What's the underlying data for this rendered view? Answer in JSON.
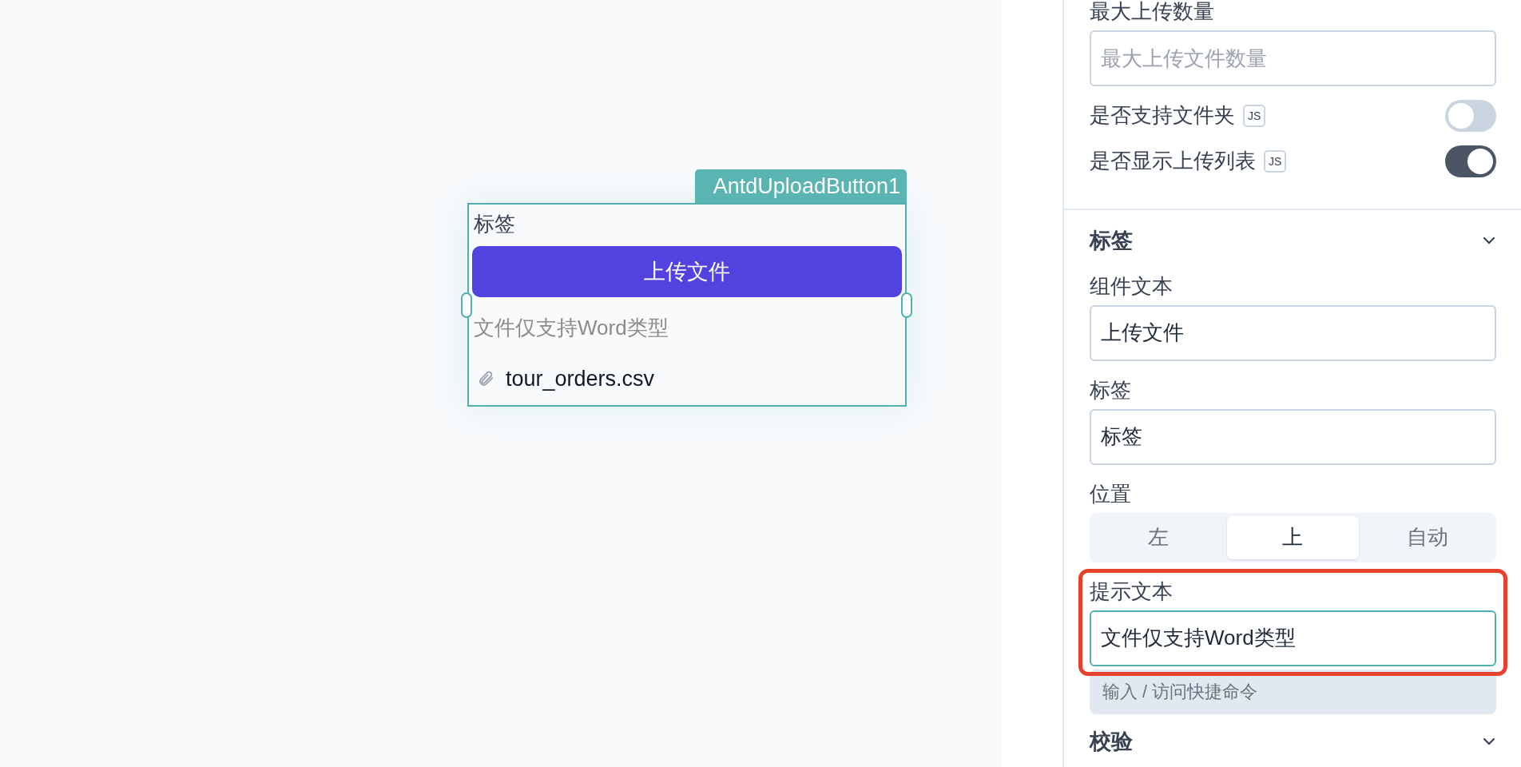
{
  "canvas": {
    "component": {
      "tag": "AntdUploadButton1",
      "label": "标签",
      "button": "上传文件",
      "hint": "文件仅支持Word类型",
      "files": [
        {
          "name": "tour_orders.csv"
        }
      ]
    }
  },
  "panel": {
    "max_upload": {
      "label": "最大上传数量",
      "placeholder": "最大上传文件数量"
    },
    "toggles": [
      {
        "label": "是否支持文件夹",
        "badge": "JS",
        "on": false
      },
      {
        "label": "是否显示上传列表",
        "badge": "JS",
        "on": true
      }
    ],
    "label_section": {
      "title": "标签",
      "expanded": true,
      "fields": [
        {
          "label": "组件文本",
          "value": "上传文件",
          "focused": false,
          "highlighted": false
        },
        {
          "label": "标签",
          "value": "标签",
          "focused": false,
          "highlighted": false
        }
      ],
      "position": {
        "label": "位置",
        "options": [
          {
            "label": "左",
            "selected": false
          },
          {
            "label": "上",
            "selected": true
          },
          {
            "label": "自动",
            "selected": false
          }
        ]
      },
      "hint_field": {
        "label": "提示文本",
        "value": "文件仅支持Word类型",
        "focused": true,
        "highlighted": true
      },
      "command_hint": "输入 / 访问快捷命令"
    },
    "validation_section": {
      "title": "校验",
      "expanded": true
    }
  }
}
